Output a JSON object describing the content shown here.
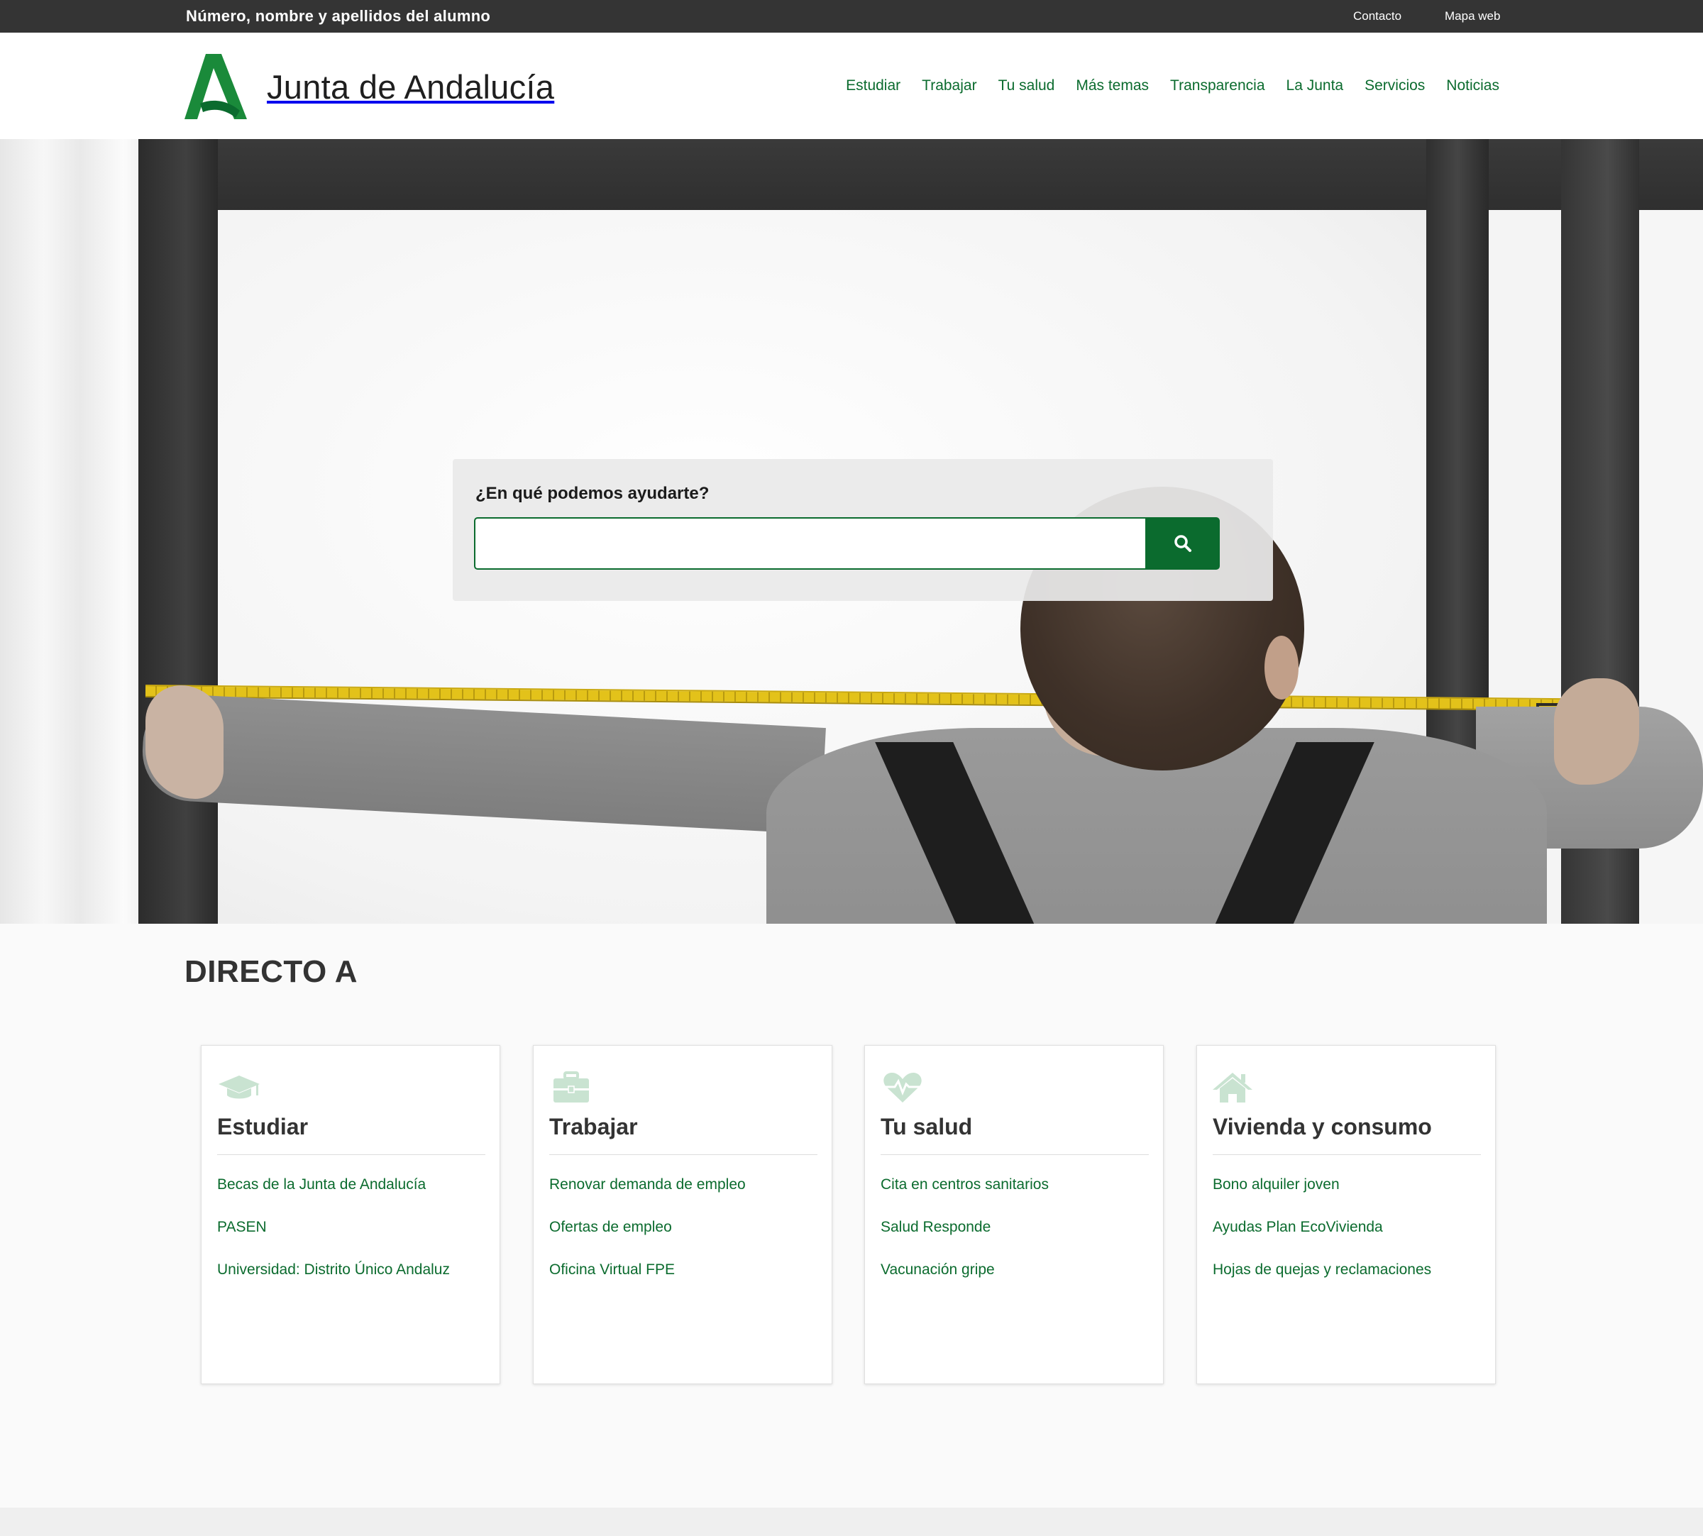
{
  "topbar": {
    "student": "Número, nombre y apellidos del alumno",
    "links": [
      "Contacto",
      "Mapa web"
    ]
  },
  "header": {
    "logo_text": "Junta de Andalucía",
    "nav": [
      "Estudiar",
      "Trabajar",
      "Tu salud",
      "Más temas",
      "Transparencia",
      "La Junta",
      "Servicios",
      "Noticias"
    ]
  },
  "search": {
    "label": "¿En qué podemos ayudarte?",
    "value": "",
    "placeholder": "",
    "button_icon": "search-icon"
  },
  "colors": {
    "brand_green": "#0b6b2e",
    "icon_green": "#c9e3d1",
    "topbar_bg": "#343434"
  },
  "directo": {
    "title": "DIRECTO A",
    "cards": [
      {
        "icon": "graduation-cap-icon",
        "title": "Estudiar",
        "links": [
          "Becas de la Junta de Andalucía",
          "PASEN",
          "Universidad: Distrito Único Andaluz"
        ]
      },
      {
        "icon": "briefcase-icon",
        "title": "Trabajar",
        "links": [
          "Renovar demanda de empleo",
          "Ofertas de empleo",
          "Oficina Virtual FPE"
        ]
      },
      {
        "icon": "heartbeat-icon",
        "title": "Tu salud",
        "links": [
          "Cita en centros sanitarios",
          "Salud Responde",
          "Vacunación gripe"
        ]
      },
      {
        "icon": "home-icon",
        "title": "Vivienda y consumo",
        "links": [
          "Bono alquiler joven",
          "Ayudas Plan EcoVivienda",
          "Hojas de quejas y reclamaciones"
        ]
      }
    ]
  }
}
